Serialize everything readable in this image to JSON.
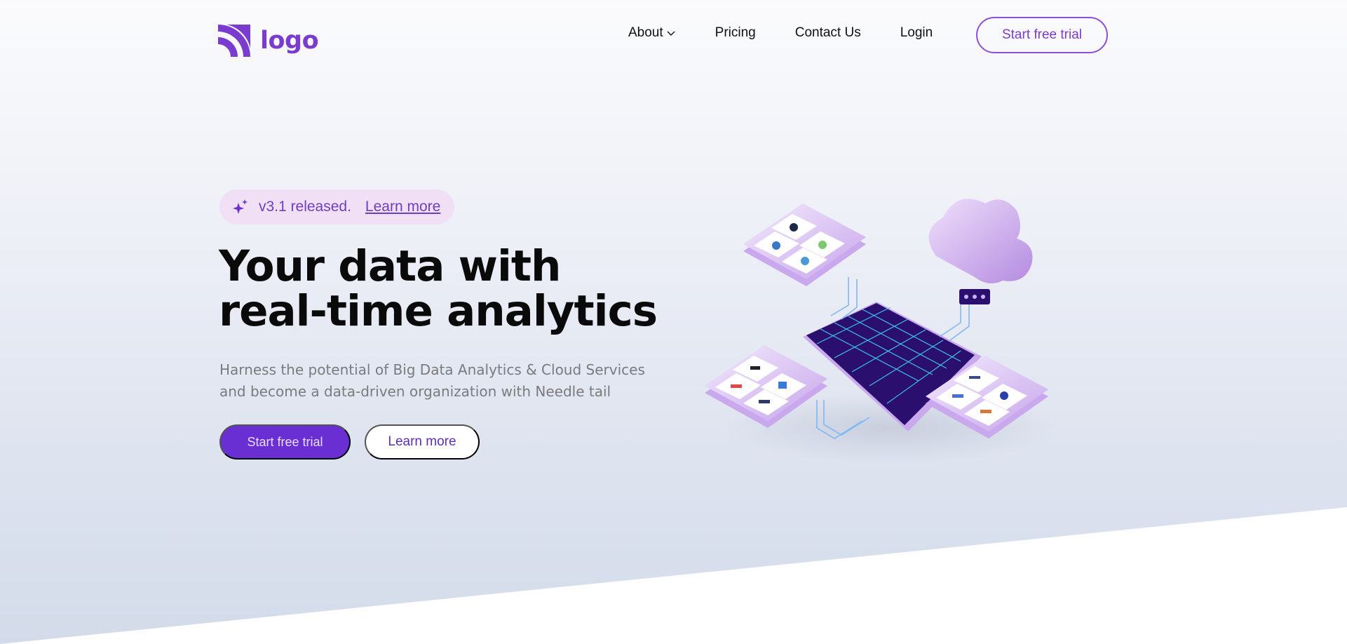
{
  "brand": {
    "logo_text": "logo",
    "accent": "#7a3ccf",
    "primary": "#6a2fd2"
  },
  "nav": {
    "items": [
      {
        "label": "About",
        "has_dropdown": true
      },
      {
        "label": "Pricing"
      },
      {
        "label": "Contact Us"
      },
      {
        "label": "Login"
      }
    ],
    "cta_label": "Start free trial"
  },
  "hero": {
    "badge_text": "v3.1 released.",
    "badge_link": "Learn more",
    "headline_line1": "Your data with",
    "headline_line2": "real-time analytics",
    "subtext_line1": "Harness the potential of Big Data Analytics & Cloud Services",
    "subtext_line2": "and become a data-driven organization with Needle tail",
    "primary_button": "Start free trial",
    "secondary_button": "Learn more"
  },
  "illustration": {
    "name": "isometric-data-platform-illustration"
  }
}
